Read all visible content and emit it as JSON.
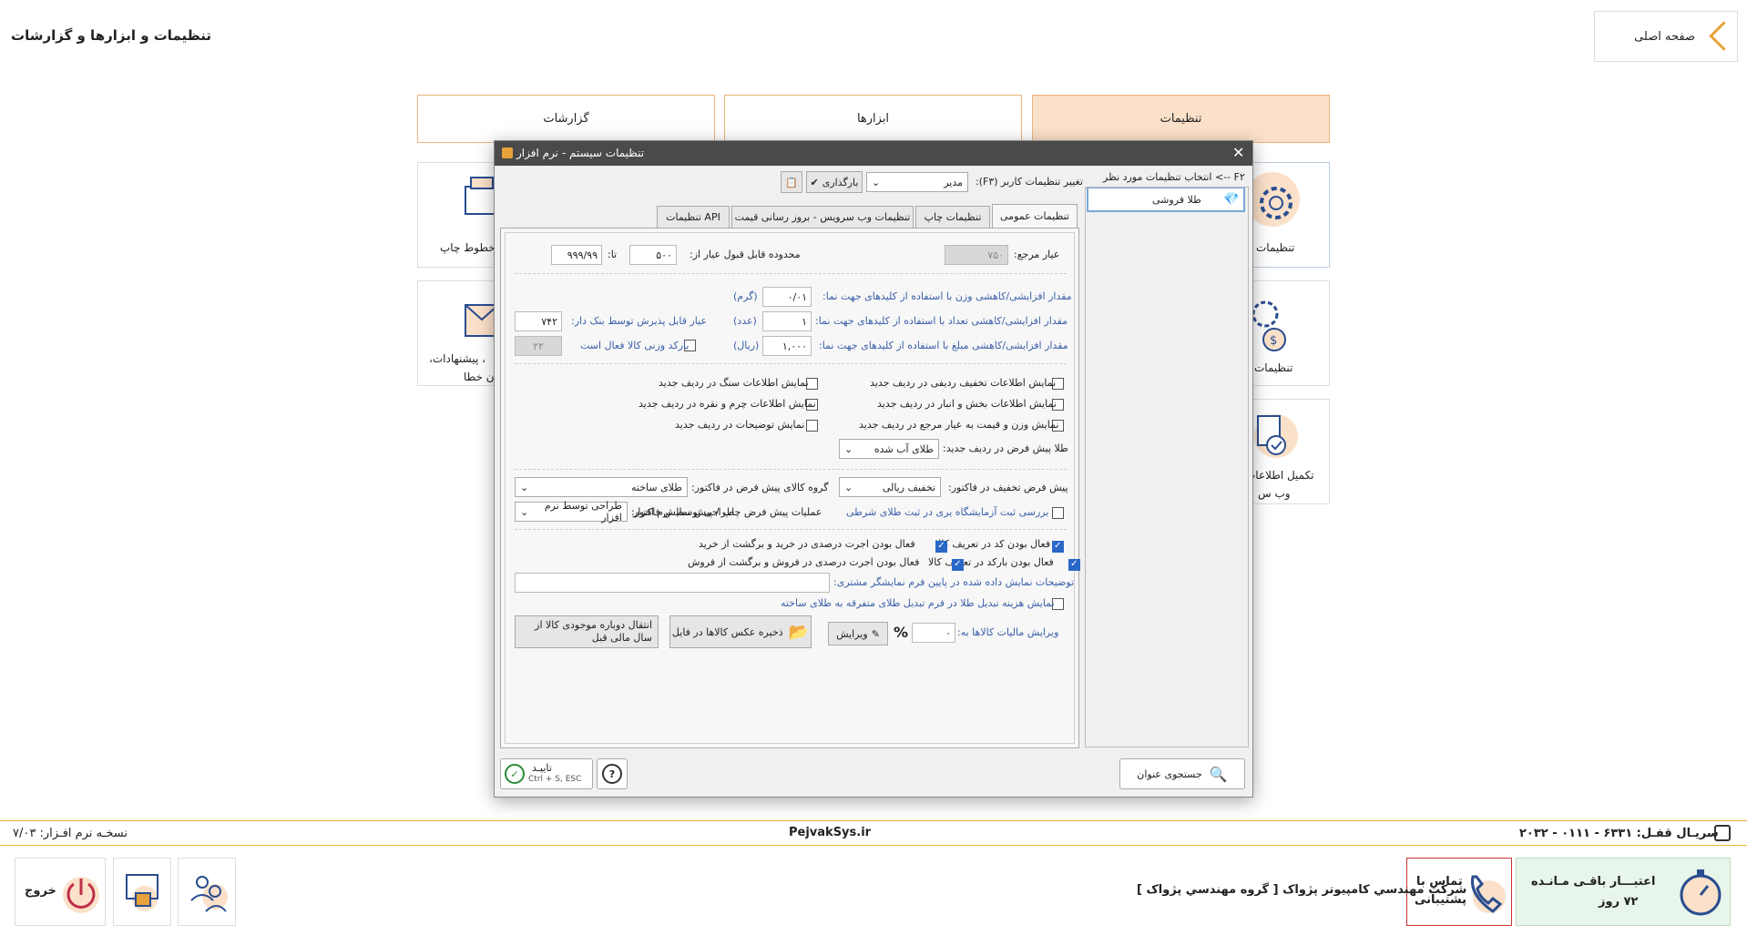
{
  "page": {
    "title": "تنظیمات و ابزارها و گزارشات",
    "home": "صفحه اصلی"
  },
  "tabs": [
    "تنظیمات",
    "ابزارها",
    "گزارشات"
  ],
  "cards": {
    "settings": "تنظیمات",
    "settings2": "تنظیمات",
    "complete1": "تکمیل اطلاعات",
    "complete2": "وب س",
    "print": "خطوط چاپ",
    "suggest1": "، پیشنهادات،",
    "suggest2": "ن خطا"
  },
  "status": {
    "serial": "سریـال قفـل: ۶۳۳۱ - ۰۱۱۱ - ۲۰۳۲",
    "site": "PejvakSys.ir",
    "version": "نسخـه نرم افـزار: ۷/۰۳"
  },
  "bottom": {
    "credit1": "اعتبـــار باقـی مـانـده",
    "credit2": "۷۲ روز",
    "support1": "تماس با",
    "support2": "پشتیبانی",
    "company": "شرکت مهندسي کامپيوتر پژواک [ گروه مهندسي پژواک ]",
    "exit": "خروج"
  },
  "dialog": {
    "title": "تنظیمات سیستم - نرم افزار",
    "left_header": "F۲ --> انتخاب تنظیمات مورد نظر",
    "left_item": "طلا فروشی",
    "left_idx": "۱",
    "user_label": "تغییر تنظیمات کاربر (F۳):",
    "user_value": "مدیر",
    "load": "بارگذاری",
    "tabs": [
      "تنظیمات عمومی",
      "تنظیمات چاپ",
      "تنظیمات وب سرویس - بروز رسانی قیمت",
      "تنظیمات API"
    ],
    "ref_label": "عیار مرجع:",
    "ref_value": "۷۵۰",
    "range_label": "محدوده قابل قبول عیار از:",
    "range_from": "۵۰۰",
    "range_to_label": "تا:",
    "range_to": "۹۹۹/۹۹",
    "w_label": "مقدار افزایشی/کاهشی وزن با استفاده از کلیدهای جهت نما:",
    "w_value": "۰/۰۱",
    "w_unit": "(گرم)",
    "c_label": "مقدار افزایشی/کاهشی تعداد با استفاده از کلیدهای جهت نما:",
    "c_value": "۱",
    "c_unit": "(عدد)",
    "m_label": "مقدار افزایشی/کاهشی مبلغ با استفاده از کلیدهای جهت نما:",
    "m_value": "۱,۰۰۰",
    "m_unit": "(ریال)",
    "bank_label": "عیار قابل پذیرش توسط بنک دار:",
    "bank_value": "۷۴۲",
    "barcode_label": "بارکد وزنی کالا فعال است",
    "barcode_value": "۲۲",
    "chk": [
      "نمایش اطلاعات تخفیف ردیفی در ردیف جدید",
      "نمایش اطلاعات بخش و انبار در ردیف جدید",
      "نمایش وزن و قیمت به عیار مرجع در ردیف جدید",
      "نمایش اطلاعات سنگ در ردیف جدید",
      "نمایش اطلاعات چرم و نقره در ردیف جدید",
      "نمایش توضیحات در ردیف جدید"
    ],
    "gold_label": "طلا پیش فرض در ردیف جدید:",
    "gold_value": "طلای آب شده",
    "disc_label": "پیش فرض تخفیف در فاکتور:",
    "disc_value": "تخفیف ریالی",
    "group_label": "گروه کالای پیش فرض در فاکتور:",
    "group_value": "طلای ساخته",
    "lab_label": "بررسی ثبت آزمایشگاه یری در ثبت طلای شرطی",
    "print_label": "عملیات پیش فرض چاپ / پیش نمایش فاکتور:",
    "print_value": "طراحی توسط نرم افزار",
    "chk2": [
      "فعال بودن کد در تعریف کالا",
      "فعال بودن بارکد در تعریف کالا",
      "فعال بودن اجرت درصدی در خرید و برگشت از خرید",
      "فعال بودن اجرت درصدی در فروش و برگشت از فروش"
    ],
    "notes_label": "توضیحات نمایش داده شده در پایین فرم نمایشگر مشتری:",
    "conv_label": "نمایش هزینه تبدیل طلا در فرم تبدیل طلای متفرقه به طلای ساخته",
    "tax_label": "ویرایش مالیات کالاها به:",
    "tax_value": "۰",
    "edit": "ویرایش",
    "save_img": "ذخیره عکس کالاها در فایل",
    "transfer": "انتقال دوباره موجودی کالا از سال مالی قبل",
    "search": "جستجوی عنوان",
    "ok": "تاییـد",
    "ok_hint": "Ctrl + S, ESC"
  }
}
